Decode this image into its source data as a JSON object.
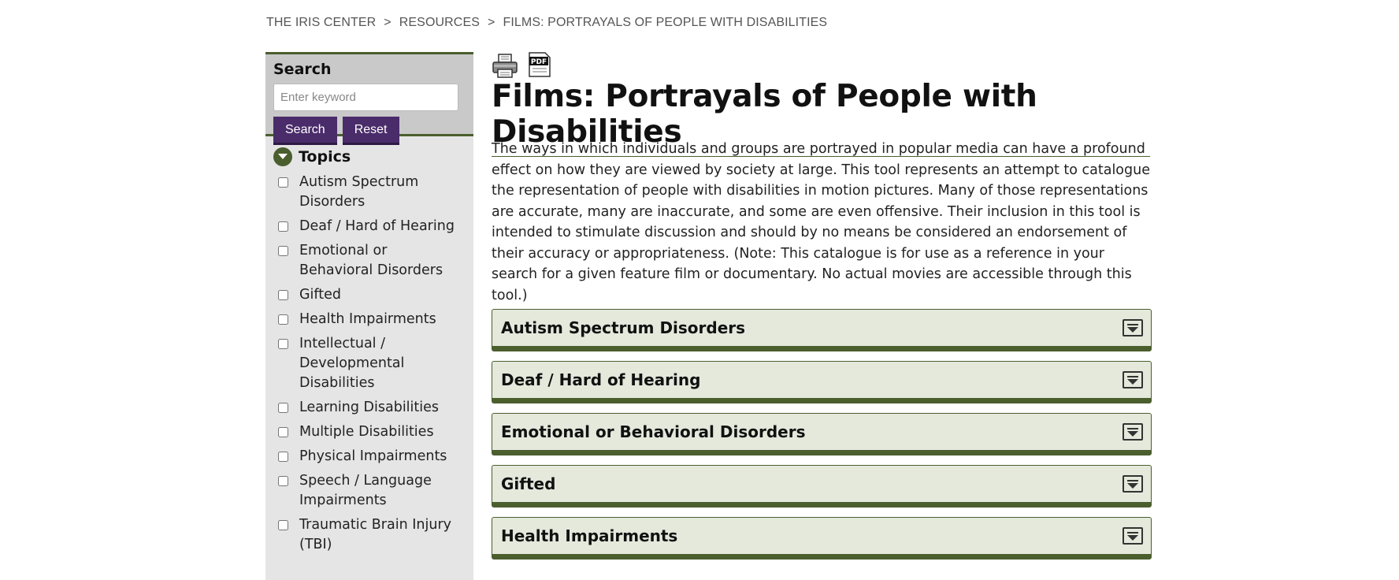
{
  "breadcrumb": {
    "items": [
      "THE IRIS CENTER",
      "RESOURCES",
      "FILMS: PORTRAYALS OF PEOPLE WITH DISABILITIES"
    ],
    "separator": ">"
  },
  "sidebar": {
    "search": {
      "title": "Search",
      "placeholder": "Enter keyword",
      "search_label": "Search",
      "reset_label": "Reset"
    },
    "topics": {
      "title": "Topics",
      "items": [
        "Autism Spectrum Disorders",
        "Deaf / Hard of Hearing",
        "Emotional or Behavioral Disorders",
        "Gifted",
        "Health Impairments",
        "Intellectual / Developmental Disabilities",
        "Learning Disabilities",
        "Multiple Disabilities",
        "Physical Impairments",
        "Speech / Language Impairments",
        "Traumatic Brain Injury (TBI)"
      ]
    }
  },
  "tools": {
    "print_icon": "printer-icon",
    "pdf_icon": "pdf-icon",
    "pdf_text": "PDF"
  },
  "main": {
    "title": "Films: Portrayals of People with Disabilities",
    "intro": "The ways in which individuals and groups are portrayed in popular media can have a profound effect on how they are viewed by society at large. This tool represents an attempt to catalogue the representation of people with disabilities in motion pictures. Many of those representations are accurate, many are inaccurate, and some are even offensive. Their inclusion in this tool is intended to stimulate discussion and should by no means be considered an endorsement of their accuracy or appropriateness. (Note: This catalogue is for use as a reference in your search for a given feature film or documentary. No actual movies are accessible through this tool.)",
    "accordions": [
      "Autism Spectrum Disorders",
      "Deaf / Hard of Hearing",
      "Emotional or Behavioral Disorders",
      "Gifted",
      "Health Impairments"
    ]
  },
  "colors": {
    "accent_green": "#4b5e2e",
    "button_purple": "#4a2c6a",
    "accordion_bg": "#e4e9dc"
  }
}
